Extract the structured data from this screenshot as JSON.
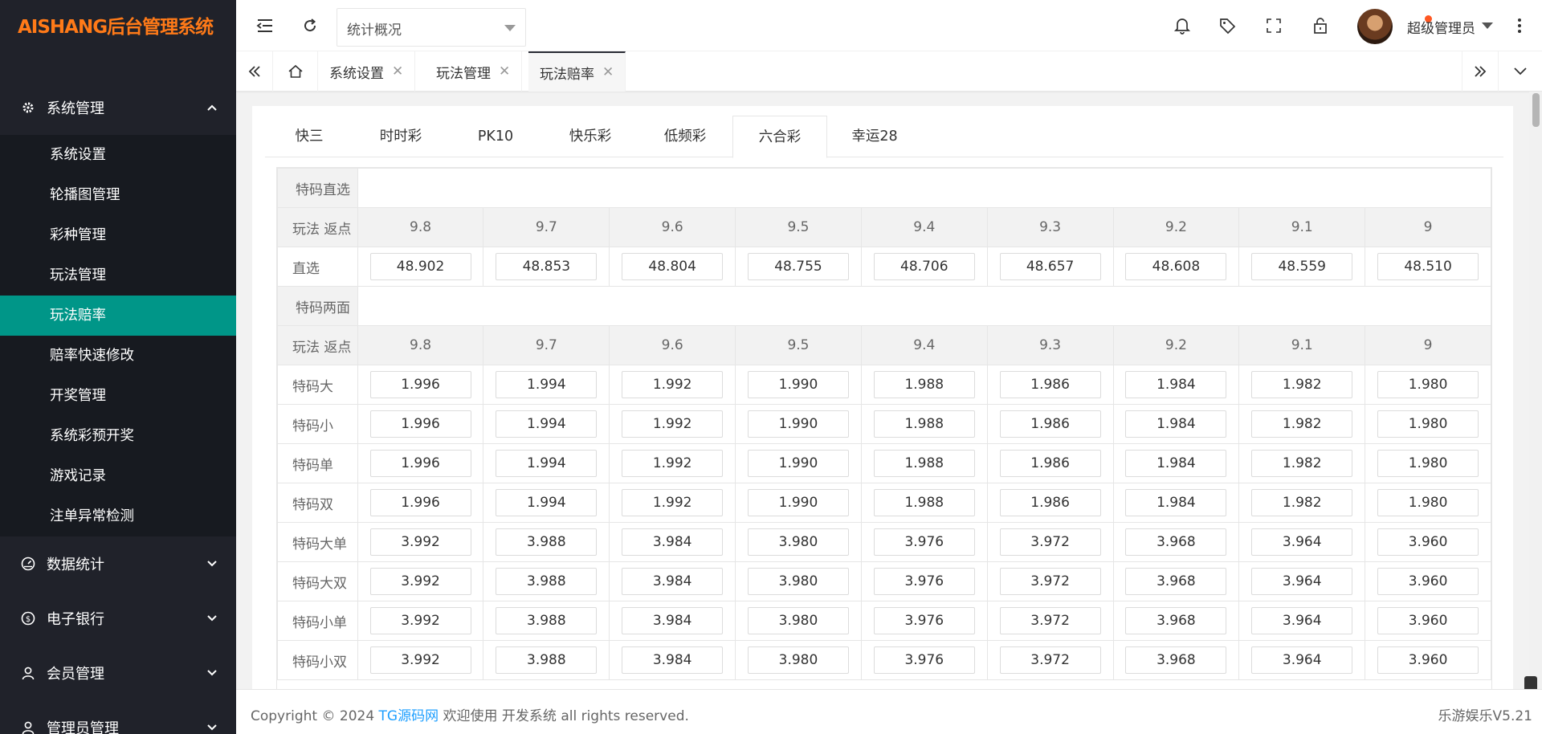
{
  "app": {
    "logo": "AISHANG后台管理系统"
  },
  "sidebar": {
    "groups": [
      {
        "label": "系统管理",
        "icon": "gear-icon",
        "expanded": true,
        "items": [
          "系统设置",
          "轮播图管理",
          "彩种管理",
          "玩法管理",
          "玩法赔率",
          "赔率快速修改",
          "开奖管理",
          "系统彩预开奖",
          "游戏记录",
          "注单异常检测"
        ],
        "active_index": 4
      },
      {
        "label": "数据统计",
        "icon": "dashboard-icon",
        "expanded": false
      },
      {
        "label": "电子银行",
        "icon": "dollar-icon",
        "expanded": false
      },
      {
        "label": "会员管理",
        "icon": "user-icon",
        "expanded": false
      },
      {
        "label": "管理员管理",
        "icon": "user-icon",
        "expanded": false
      }
    ]
  },
  "topbar": {
    "select_value": "统计概况",
    "user_name": "超级管理员"
  },
  "page_tabs": [
    {
      "label": "系统设置",
      "active": false
    },
    {
      "label": "玩法管理",
      "active": false
    },
    {
      "label": "玩法赔率",
      "active": true
    }
  ],
  "game_tabs": [
    "快三",
    "时时彩",
    "PK10",
    "快乐彩",
    "低频彩",
    "六合彩",
    "幸运28"
  ],
  "game_tab_active": 5,
  "odds": {
    "header_label": "玩法 返点",
    "rebates": [
      "9.8",
      "9.7",
      "9.6",
      "9.5",
      "9.4",
      "9.3",
      "9.2",
      "9.1",
      "9"
    ],
    "sections": [
      {
        "title": "特码直选",
        "rows": [
          {
            "label": "直选",
            "values": [
              "48.902",
              "48.853",
              "48.804",
              "48.755",
              "48.706",
              "48.657",
              "48.608",
              "48.559",
              "48.510"
            ]
          }
        ]
      },
      {
        "title": "特码两面",
        "rows": [
          {
            "label": "特码大",
            "values": [
              "1.996",
              "1.994",
              "1.992",
              "1.990",
              "1.988",
              "1.986",
              "1.984",
              "1.982",
              "1.980"
            ]
          },
          {
            "label": "特码小",
            "values": [
              "1.996",
              "1.994",
              "1.992",
              "1.990",
              "1.988",
              "1.986",
              "1.984",
              "1.982",
              "1.980"
            ]
          },
          {
            "label": "特码单",
            "values": [
              "1.996",
              "1.994",
              "1.992",
              "1.990",
              "1.988",
              "1.986",
              "1.984",
              "1.982",
              "1.980"
            ]
          },
          {
            "label": "特码双",
            "values": [
              "1.996",
              "1.994",
              "1.992",
              "1.990",
              "1.988",
              "1.986",
              "1.984",
              "1.982",
              "1.980"
            ]
          },
          {
            "label": "特码大单",
            "values": [
              "3.992",
              "3.988",
              "3.984",
              "3.980",
              "3.976",
              "3.972",
              "3.968",
              "3.964",
              "3.960"
            ]
          },
          {
            "label": "特码大双",
            "values": [
              "3.992",
              "3.988",
              "3.984",
              "3.980",
              "3.976",
              "3.972",
              "3.968",
              "3.964",
              "3.960"
            ]
          },
          {
            "label": "特码小单",
            "values": [
              "3.992",
              "3.988",
              "3.984",
              "3.980",
              "3.976",
              "3.972",
              "3.968",
              "3.964",
              "3.960"
            ]
          },
          {
            "label": "特码小双",
            "values": [
              "3.992",
              "3.988",
              "3.984",
              "3.980",
              "3.976",
              "3.972",
              "3.968",
              "3.964",
              "3.960"
            ]
          }
        ]
      }
    ]
  },
  "footer": {
    "copy_prefix": "Copyright © 2024",
    "copy_link": "TG源码网",
    "copy_suffix": "欢迎使用 开发系统 all rights reserved.",
    "version": "乐游娱乐V5.21"
  },
  "colors": {
    "sidebar_bg": "#20222a",
    "submenu_bg": "#171a20",
    "active_item": "#009688",
    "logo": "#ff7a18",
    "link": "#1e9fff",
    "badge": "#ff5722"
  }
}
